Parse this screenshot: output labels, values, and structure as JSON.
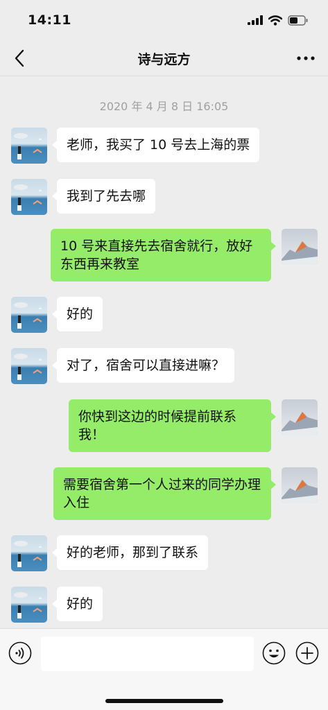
{
  "status_bar": {
    "time": "14:11",
    "icons": [
      "signal-icon",
      "wifi-icon",
      "battery-icon"
    ]
  },
  "nav": {
    "back_icon": "chevron-left-icon",
    "title": "诗与远方",
    "more_icon": "more-dots-icon"
  },
  "timestamp": "2020 年 4 月 8 日 16:05",
  "messages": [
    {
      "side": "left",
      "text": "老师，我买了 10 号去上海的票"
    },
    {
      "side": "left",
      "text": "我到了先去哪"
    },
    {
      "side": "right",
      "text": "10 号来直接先去宿舍就行，放好东西再来教室"
    },
    {
      "side": "left",
      "text": "好的"
    },
    {
      "side": "left",
      "text": "对了，宿舍可以直接进嘛？"
    },
    {
      "side": "right",
      "text": "你快到这边的时候提前联系我！"
    },
    {
      "side": "right",
      "text": "需要宿舍第一个人过来的同学办理入住"
    },
    {
      "side": "left",
      "text": "好的老师，那到了联系"
    },
    {
      "side": "left",
      "text": "好的"
    }
  ],
  "input_bar": {
    "voice_icon": "voice-icon",
    "text_value": "",
    "emoji_icon": "emoji-icon",
    "plus_icon": "plus-icon"
  },
  "colors": {
    "background": "#ededed",
    "self_bubble": "#95ec69",
    "other_bubble": "#ffffff"
  }
}
